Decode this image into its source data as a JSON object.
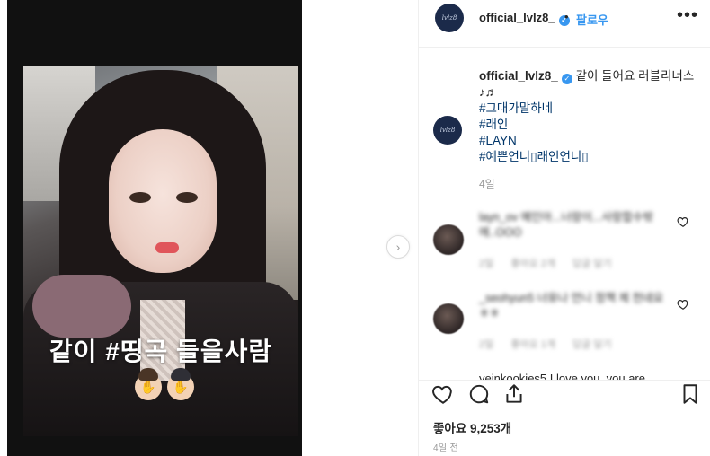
{
  "post": {
    "media_overlay_text": "같이 #띵곡 들을사람",
    "next_button_glyph": "›"
  },
  "header": {
    "avatar_text": "lvlz8",
    "username": "official_lvlz8_",
    "separator": "•",
    "follow_label": "팔로우",
    "more_glyph": "•••"
  },
  "caption": {
    "avatar_text": "lvlz8",
    "username": "official_lvlz8_",
    "text": "같이 들어요 러블리너스♪♬",
    "hashtags": [
      "#그대가말하네",
      "#래인",
      "#LAYN",
      "#예쁜언니▯래인언니▯"
    ],
    "age": "4일"
  },
  "comments": [
    {
      "text": "layn_ov 예인아...너랑이...사랑합수밖에..OOO",
      "meta": [
        "2일",
        "좋아요 2개",
        "답글 달기"
      ]
    },
    {
      "text": "_seohyun5 너유나 언니 정책 제 천네요ㅎㅎ",
      "meta": [
        "2일",
        "좋아요 1개",
        "답글 달기"
      ]
    }
  ],
  "partial_comment": "yeinkookies5 I love you, you are",
  "likes": "좋아요 9,253개",
  "posted": "4일 전",
  "colors": {
    "accent_blue": "#3897f0",
    "hashtag_blue": "#003569",
    "muted": "#999999"
  },
  "icons": [
    "verified-icon",
    "more-icon",
    "heart-icon",
    "comment-icon",
    "share-icon",
    "bookmark-icon",
    "chevron-right-icon"
  ]
}
